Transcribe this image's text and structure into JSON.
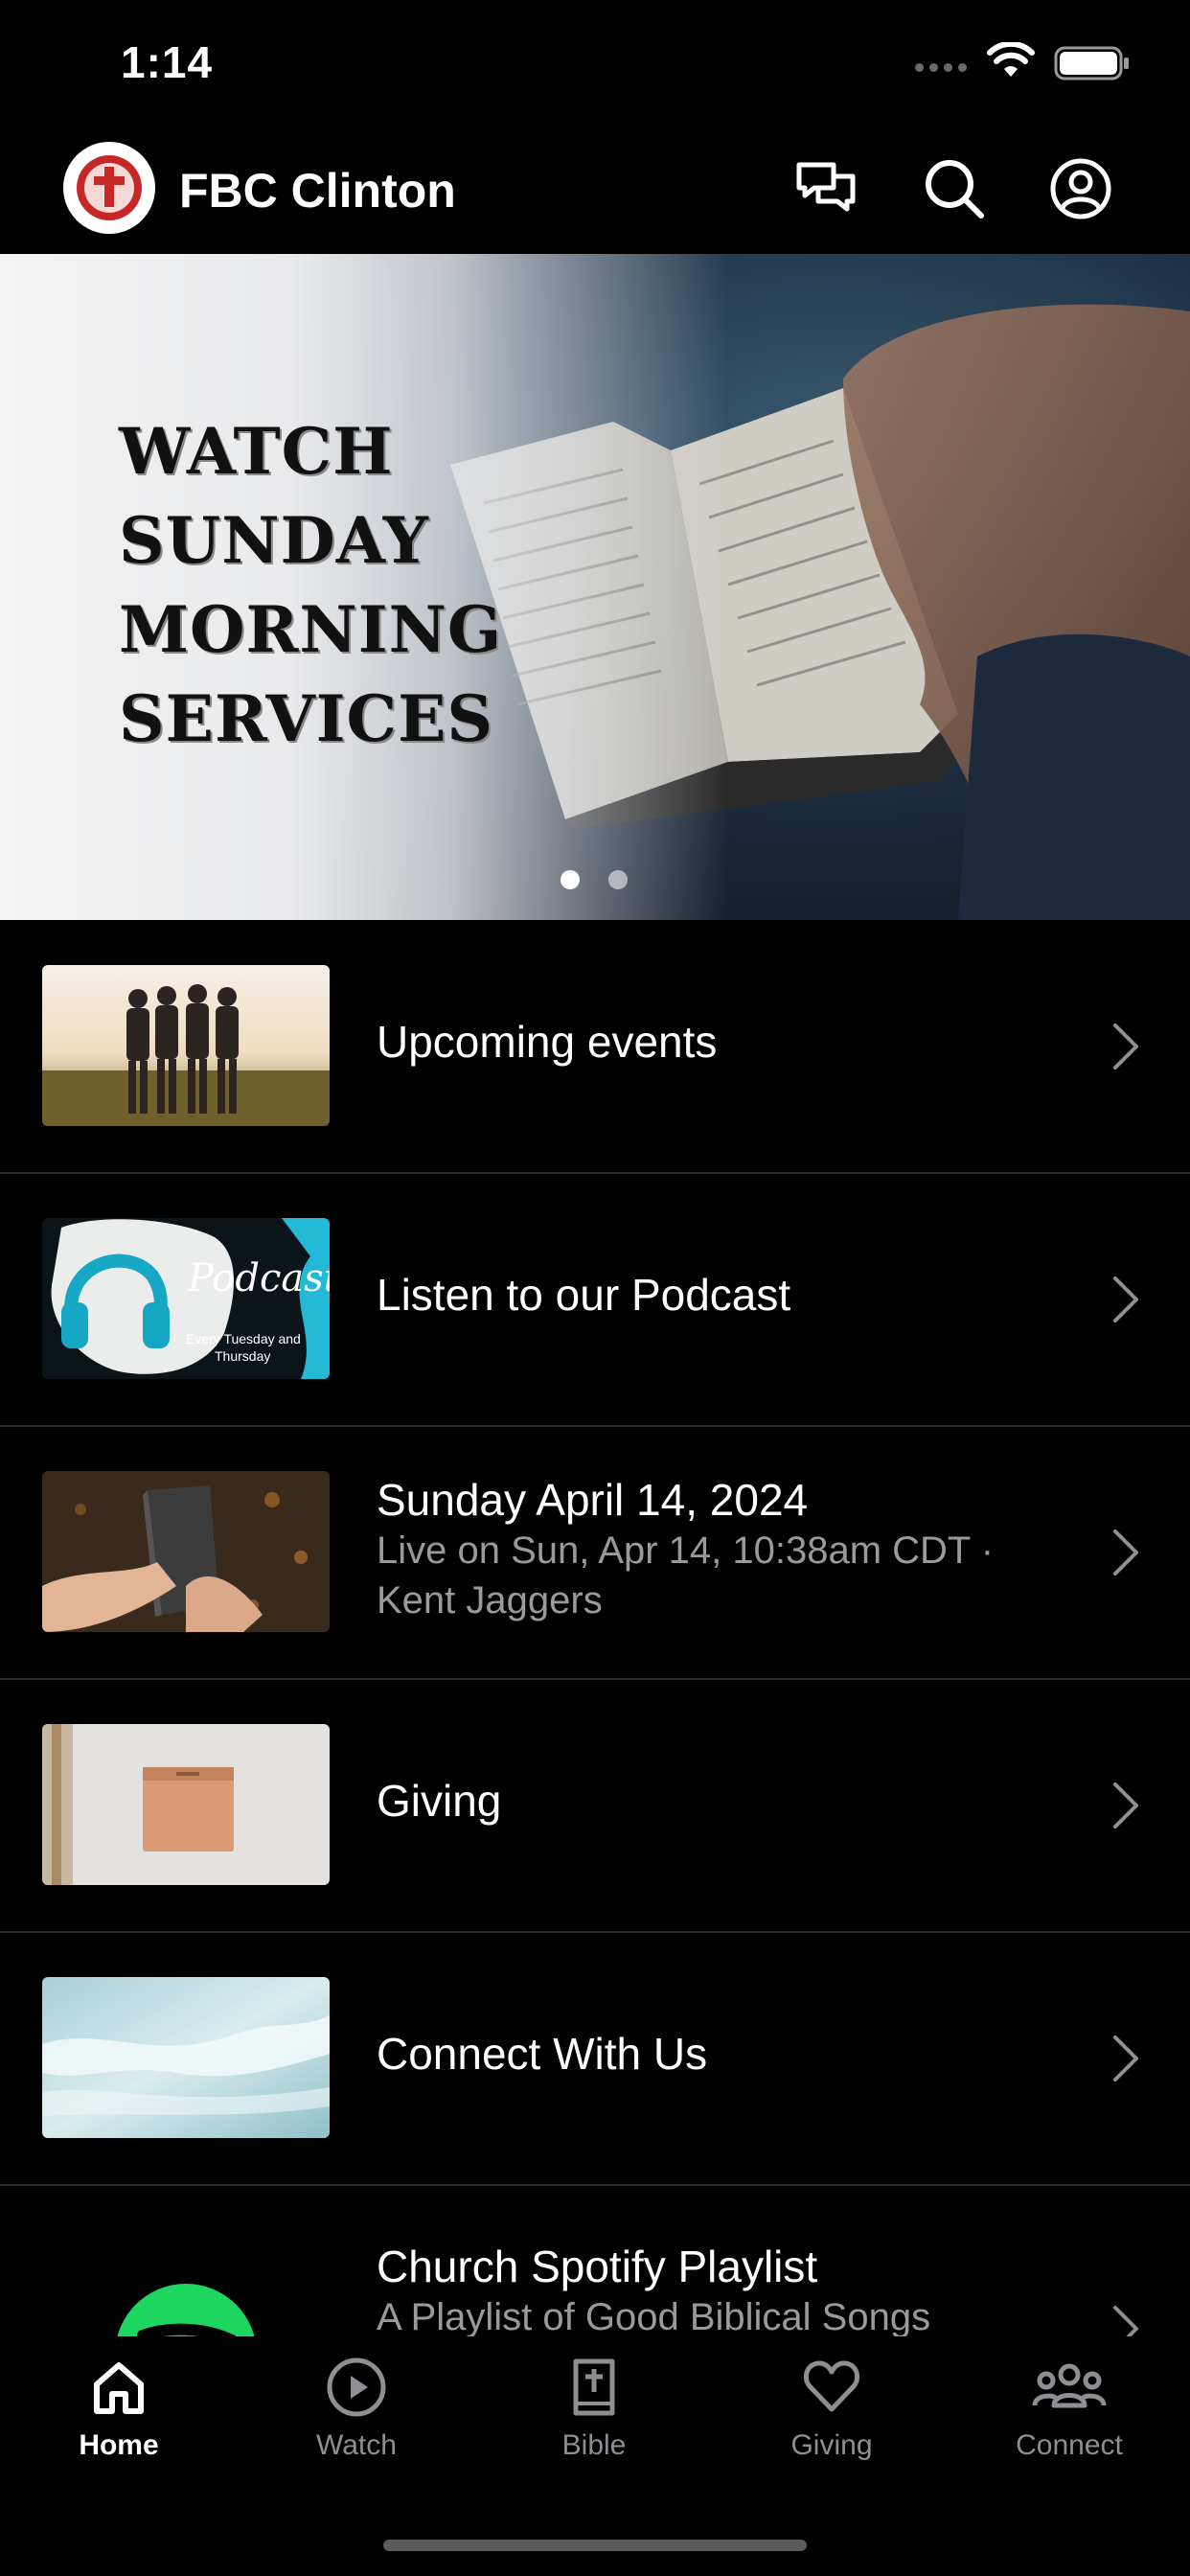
{
  "status_bar": {
    "time": "1:14"
  },
  "header": {
    "title": "FBC Clinton",
    "icons": [
      "chat-icon",
      "search-icon",
      "profile-icon"
    ]
  },
  "hero": {
    "title_lines": [
      "WATCH",
      "SUNDAY",
      "MORNING",
      "SERVICES"
    ],
    "active_page": 1,
    "page_count": 2
  },
  "items": [
    {
      "title": "Upcoming events",
      "subtitle": "",
      "subtitle2": ""
    },
    {
      "title": "Listen to our Podcast",
      "subtitle": "",
      "subtitle2": "",
      "thumb_text": {
        "podcast": "Podcast",
        "line1": "Every Tuesday and",
        "line2": "Thursday"
      }
    },
    {
      "title": "Sunday April 14, 2024",
      "subtitle": "Live on Sun, Apr 14, 10:38am CDT ·",
      "subtitle2": "Kent Jaggers"
    },
    {
      "title": "Giving",
      "subtitle": "",
      "subtitle2": ""
    },
    {
      "title": "Connect With Us",
      "subtitle": "",
      "subtitle2": ""
    },
    {
      "title": "Church Spotify Playlist",
      "subtitle": "A Playlist of Good Biblical Songs",
      "subtitle2": ""
    }
  ],
  "tabs": [
    {
      "label": "Home",
      "icon": "home-icon",
      "active": true
    },
    {
      "label": "Watch",
      "icon": "play-icon",
      "active": false
    },
    {
      "label": "Bible",
      "icon": "bible-icon",
      "active": false
    },
    {
      "label": "Giving",
      "icon": "heart-icon",
      "active": false
    },
    {
      "label": "Connect",
      "icon": "people-icon",
      "active": false
    }
  ],
  "colors": {
    "background": "#000000",
    "active_tab": "#ffffff",
    "inactive_tab": "#8e8e93",
    "spotify_green": "#1ed760"
  }
}
